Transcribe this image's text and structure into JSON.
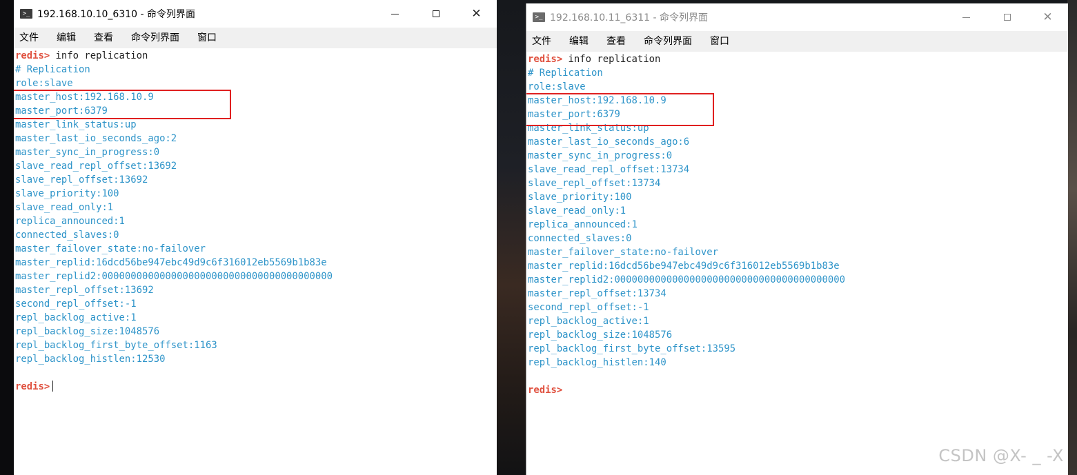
{
  "menu_labels": [
    "文件",
    "编辑",
    "查看",
    "命令列界面",
    "窗口"
  ],
  "window_left": {
    "title": "192.168.10.10_6310 - 命令列界面",
    "prompt": "redis>",
    "command": " info replication",
    "output": [
      "# Replication",
      "role:slave",
      "master_host:192.168.10.9",
      "master_port:6379",
      "master_link_status:up",
      "master_last_io_seconds_ago:2",
      "master_sync_in_progress:0",
      "slave_read_repl_offset:13692",
      "slave_repl_offset:13692",
      "slave_priority:100",
      "slave_read_only:1",
      "replica_announced:1",
      "connected_slaves:0",
      "master_failover_state:no-failover",
      "master_replid:16dcd56be947ebc49d9c6f316012eb5569b1b83e",
      "master_replid2:0000000000000000000000000000000000000000",
      "master_repl_offset:13692",
      "second_repl_offset:-1",
      "repl_backlog_active:1",
      "repl_backlog_size:1048576",
      "repl_backlog_first_byte_offset:1163",
      "repl_backlog_histlen:12530"
    ],
    "final_prompt": "redis>"
  },
  "window_right": {
    "title": "192.168.10.11_6311 - 命令列界面",
    "prompt": "redis>",
    "command": " info replication",
    "output": [
      "# Replication",
      "role:slave",
      "master_host:192.168.10.9",
      "master_port:6379",
      "master_link_status:up",
      "master_last_io_seconds_ago:6",
      "master_sync_in_progress:0",
      "slave_read_repl_offset:13734",
      "slave_repl_offset:13734",
      "slave_priority:100",
      "slave_read_only:1",
      "replica_announced:1",
      "connected_slaves:0",
      "master_failover_state:no-failover",
      "master_replid:16dcd56be947ebc49d9c6f316012eb5569b1b83e",
      "master_replid2:0000000000000000000000000000000000000000",
      "master_repl_offset:13734",
      "second_repl_offset:-1",
      "repl_backlog_active:1",
      "repl_backlog_size:1048576",
      "repl_backlog_first_byte_offset:13595",
      "repl_backlog_histlen:140"
    ],
    "final_prompt": "redis>"
  },
  "watermark": "CSDN @X- _ -X",
  "colors": {
    "prompt": "#e0513f",
    "output": "#2e94c9",
    "highlight": "#e02020"
  },
  "icons": {
    "app": "terminal-icon",
    "minimize": "minimize-icon",
    "maximize": "maximize-icon",
    "close": "close-icon"
  }
}
